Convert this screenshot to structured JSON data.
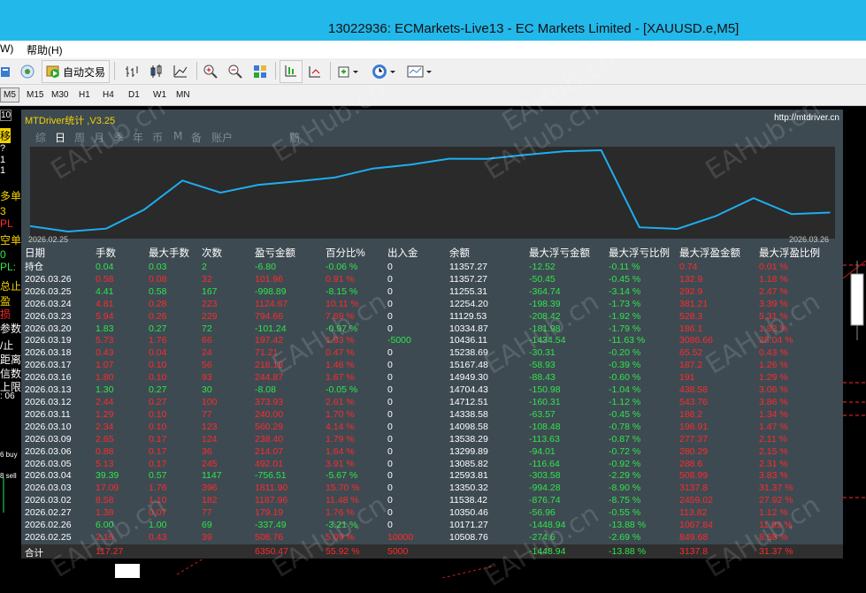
{
  "window": {
    "title": "13022936: ECMarkets-Live13 - EC Markets Limited - [XAUUSD.e,M5]"
  },
  "menu": {
    "items": [
      "W)",
      "帮助(H)"
    ]
  },
  "toolbar": {
    "auto_trade_label": "自动交易"
  },
  "timeframes": [
    "M5",
    "M15",
    "M30",
    "H1",
    "H4",
    "D1",
    "W1",
    "MN"
  ],
  "left_strip": {
    "items": [
      "10",
      "移",
      "?",
      "1",
      "1",
      "多单",
      "3",
      "PL",
      "空单",
      "0",
      "PL:",
      "总止",
      "盈",
      "损",
      "参数",
      "/止",
      "距离",
      "信数",
      "上限",
      ": 06",
      "6 buy",
      "8 sell"
    ]
  },
  "panel": {
    "title": "MTDriver统计 ,V3.25",
    "link": "http://mtdriver.cn",
    "tabs": [
      "综",
      "日",
      "周",
      "月",
      "季",
      "年",
      "币",
      "M",
      "备",
      "账户",
      "赔"
    ],
    "active_tab": "日",
    "tabs_extra": "赔",
    "chart": {
      "start_date": "2026.02.25",
      "end_date": "2026.03.26"
    }
  },
  "chart_data": {
    "type": "line",
    "x": [
      "2026.02.25",
      "2026.02.26",
      "2026.02.27",
      "2026.03.02",
      "2026.03.03",
      "2026.03.04",
      "2026.03.05",
      "2026.03.06",
      "2026.03.09",
      "2026.03.10",
      "2026.03.11",
      "2026.03.12",
      "2026.03.13",
      "2026.03.16",
      "2026.03.17",
      "2026.03.18",
      "2026.03.19",
      "2026.03.20",
      "2026.03.23",
      "2026.03.24",
      "2026.03.25",
      "2026.03.26"
    ],
    "series": [
      {
        "values": [
          10508.76,
          10171.27,
          10350.46,
          11538.42,
          13350.32,
          12593.81,
          13085.82,
          13299.89,
          13538.29,
          14098.58,
          14338.58,
          14712.51,
          14704.43,
          14949.3,
          15167.48,
          15238.69,
          10436.11,
          10334.87,
          11129.53,
          12254.2,
          11255.31,
          11357.27
        ]
      }
    ]
  },
  "table": {
    "headers": [
      "日期",
      "手数",
      "最大手数",
      "次数",
      "盈亏金额",
      "百分比%",
      "出入金",
      "余额",
      "最大浮亏金额",
      "最大浮亏比例",
      "最大浮盈金额",
      "最大浮盈比例"
    ],
    "rows": [
      [
        "持仓",
        "0.04",
        "0.03",
        "2",
        "-6.80",
        "-0.06 %",
        "0",
        "11357.27",
        "-12.52",
        "-0.11 %",
        "0.74",
        "0.01 %"
      ],
      [
        "2026.03.26",
        "0.58",
        "0.08",
        "32",
        "101.96",
        "0.91 %",
        "0",
        "11357.27",
        "-50.45",
        "-0.45 %",
        "132.9",
        "1.18 %"
      ],
      [
        "2026.03.25",
        "4.41",
        "0.58",
        "167",
        "-998.89",
        "-8.15 %",
        "0",
        "11255.31",
        "-364.74",
        "-3.14 %",
        "292.9",
        "2.47 %"
      ],
      [
        "2026.03.24",
        "4.81",
        "0.28",
        "223",
        "1124.67",
        "10.11 %",
        "0",
        "12254.20",
        "-198.39",
        "-1.73 %",
        "381.21",
        "3.39 %"
      ],
      [
        "2026.03.23",
        "5.94",
        "0.26",
        "229",
        "794.66",
        "7.69 %",
        "0",
        "11129.53",
        "-208.42",
        "-1.92 %",
        "528.3",
        "5.31 %"
      ],
      [
        "2026.03.20",
        "1.83",
        "0.27",
        "72",
        "-101.24",
        "-0.97 %",
        "0",
        "10334.87",
        "-181.98",
        "-1.79 %",
        "186.1",
        "1.83 %"
      ],
      [
        "2026.03.19",
        "5.73",
        "1.76",
        "66",
        "197.42",
        "1.93 %",
        "-5000",
        "10436.11",
        "-1434.54",
        "-11.63 %",
        "3086.66",
        "25.04 %"
      ],
      [
        "2026.03.18",
        "0.43",
        "0.04",
        "24",
        "71.21",
        "0.47 %",
        "0",
        "15238.69",
        "-30.31",
        "-0.20 %",
        "65.52",
        "0.43 %"
      ],
      [
        "2026.03.17",
        "1.07",
        "0.10",
        "56",
        "218.18",
        "1.46 %",
        "0",
        "15167.48",
        "-58.93",
        "-0.39 %",
        "187.2",
        "1.26 %"
      ],
      [
        "2026.03.16",
        "1.80",
        "0.10",
        "93",
        "244.87",
        "1.67 %",
        "0",
        "14949.30",
        "-88.43",
        "-0.60 %",
        "191",
        "1.29 %"
      ],
      [
        "2026.03.13",
        "1.30",
        "0.27",
        "30",
        "-8.08",
        "-0.05 %",
        "0",
        "14704.43",
        "-150.98",
        "-1.04 %",
        "438.58",
        "3.06 %"
      ],
      [
        "2026.03.12",
        "2.44",
        "0.27",
        "100",
        "373.93",
        "2.61 %",
        "0",
        "14712.51",
        "-160.31",
        "-1.12 %",
        "543.76",
        "3.86 %"
      ],
      [
        "2026.03.11",
        "1.29",
        "0.10",
        "77",
        "240.00",
        "1.70 %",
        "0",
        "14338.58",
        "-63.57",
        "-0.45 %",
        "188.2",
        "1.34 %"
      ],
      [
        "2026.03.10",
        "2.34",
        "0.10",
        "123",
        "560.29",
        "4.14 %",
        "0",
        "14098.58",
        "-108.48",
        "-0.78 %",
        "198.91",
        "1.47 %"
      ],
      [
        "2026.03.09",
        "2.65",
        "0.17",
        "124",
        "238.40",
        "1.79 %",
        "0",
        "13538.29",
        "-113.63",
        "-0.87 %",
        "277.37",
        "2.11 %"
      ],
      [
        "2026.03.06",
        "0.88",
        "0.17",
        "36",
        "214.07",
        "1.64 %",
        "0",
        "13299.89",
        "-94.01",
        "-0.72 %",
        "280.29",
        "2.15 %"
      ],
      [
        "2026.03.05",
        "5.13",
        "0.17",
        "245",
        "492.01",
        "3.91 %",
        "0",
        "13085.82",
        "-116.64",
        "-0.92 %",
        "288.6",
        "2.31 %"
      ],
      [
        "2026.03.04",
        "39.39",
        "0.57",
        "1147",
        "-756.51",
        "-5.67 %",
        "0",
        "12593.81",
        "-303.58",
        "-2.29 %",
        "508.99",
        "3.83 %"
      ],
      [
        "2026.03.03",
        "17.09",
        "1.76",
        "396",
        "1811.90",
        "15.70 %",
        "0",
        "13350.32",
        "-994.28",
        "-8.90 %",
        "3137.8",
        "31.37 %"
      ],
      [
        "2026.03.02",
        "8.58",
        "1.10",
        "182",
        "1187.96",
        "11.48 %",
        "0",
        "11538.42",
        "-876.74",
        "-8.75 %",
        "2459.02",
        "27.92 %"
      ],
      [
        "2026.02.27",
        "1.38",
        "0.07",
        "77",
        "179.19",
        "1.76 %",
        "0",
        "10350.46",
        "-56.96",
        "-0.55 %",
        "113.82",
        "1.12 %"
      ],
      [
        "2026.02.26",
        "6.00",
        "1.00",
        "69",
        "-337.49",
        "-3.21 %",
        "0",
        "10171.27",
        "-1448.94",
        "-13.88 %",
        "1067.84",
        "11.93 %"
      ],
      [
        "2026.02.25",
        "2.16",
        "0.43",
        "39",
        "508.76",
        "5.09 %",
        "10000",
        "10508.76",
        "-274.6",
        "-2.69 %",
        "849.68",
        "8.58 %"
      ]
    ],
    "totals": {
      "label": "合计",
      "lots": "117.27",
      "profit": "6350.47",
      "percent": "55.92 %",
      "deposit": "5000",
      "max_float_loss": "-1448.94",
      "max_float_loss_pct": "-13.88 %",
      "max_float_profit": "3137.8",
      "max_float_profit_pct": "31.37 %"
    }
  },
  "watermark": "EAHub.cn",
  "colors": {
    "titlebar": "#23b8ea",
    "panel_bg": "#3e4a52",
    "positive": "#2ee64a",
    "negative": "#ff2a2a",
    "equity_line": "#1eaef0",
    "title_yellow": "#f4d200"
  }
}
